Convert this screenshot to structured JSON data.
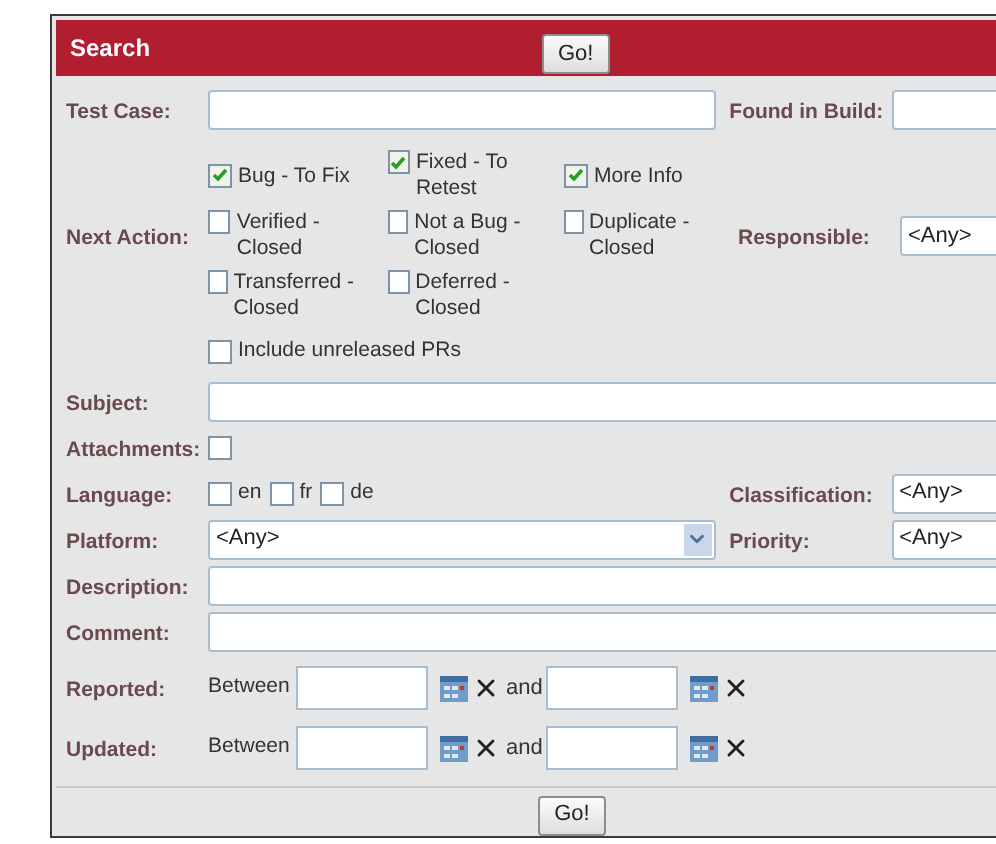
{
  "header": {
    "title": "Search",
    "button": "Go!"
  },
  "test_case": {
    "label": "Test Case:"
  },
  "found_in_build": {
    "label": "Found in Build:"
  },
  "next_action": {
    "label": "Next Action:",
    "options": [
      {
        "label": "Bug - To Fix",
        "checked": true
      },
      {
        "label": "Fixed - To Retest",
        "checked": true
      },
      {
        "label": "More Info",
        "checked": true
      },
      {
        "label": "Verified - Closed",
        "checked": false
      },
      {
        "label": "Not a Bug - Closed",
        "checked": false
      },
      {
        "label": "Duplicate - Closed",
        "checked": false
      },
      {
        "label": "Transferred - Closed",
        "checked": false
      },
      {
        "label": "Deferred - Closed",
        "checked": false
      }
    ],
    "include_unreleased": {
      "label": "Include unreleased PRs",
      "checked": false
    }
  },
  "responsible": {
    "label": "Responsible:",
    "value": "<Any>"
  },
  "subject": {
    "label": "Subject:"
  },
  "attachments": {
    "label": "Attachments:",
    "checked": false
  },
  "language": {
    "label": "Language:",
    "options": [
      {
        "label": "en",
        "checked": false
      },
      {
        "label": "fr",
        "checked": false
      },
      {
        "label": "de",
        "checked": false
      }
    ]
  },
  "classification": {
    "label": "Classification:",
    "value": "<Any>"
  },
  "platform": {
    "label": "Platform:",
    "value": "<Any>"
  },
  "priority": {
    "label": "Priority:",
    "value": "<Any>"
  },
  "description": {
    "label": "Description:"
  },
  "comment": {
    "label": "Comment:"
  },
  "date_ranges": [
    {
      "label": "Reported:",
      "between": "Between",
      "and": "and"
    },
    {
      "label": "Updated:",
      "between": "Between",
      "and": "and"
    }
  ],
  "footer_button": "Go!"
}
